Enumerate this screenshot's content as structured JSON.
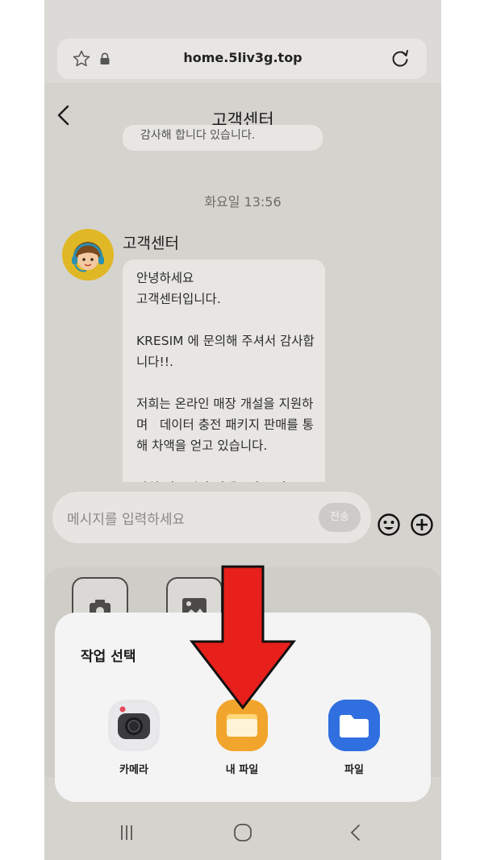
{
  "browser": {
    "url": "home.5liv3g.top"
  },
  "header": {
    "back_icon": "chevron-left-icon",
    "title": "고객센터"
  },
  "chat": {
    "previous_snippet": "감사해 합니다 있습니다.",
    "timestamp": "화요일 13:56",
    "sender": "고객센터",
    "message": "안녕하세요\n고객센터입니다.\n\nKRESIM 에 문의해 주셔서 감사합니다!!.\n\n저희는 온라인 매장 개설을 지원하며   데이터 충전 패키지 판매를 통해 차액을 얻고 있습니다.\n\n관심 있으시면 언제든지 문의"
  },
  "composer": {
    "placeholder": "메시지를 입력하세요",
    "send_label": "전송",
    "emoji_icon": "smiley-icon",
    "plus_icon": "plus-circle-icon"
  },
  "tray": {
    "buttons": [
      "camera-icon",
      "image-icon"
    ]
  },
  "sheet": {
    "title": "작업 선택",
    "apps": [
      {
        "label": "카메라",
        "icon": "camera-app-icon",
        "color": "#e9e9ec"
      },
      {
        "label": "내 파일",
        "icon": "my-files-icon",
        "color": "#f2a52c"
      },
      {
        "label": "파일",
        "icon": "files-icon",
        "color": "#2f6fe0"
      }
    ]
  },
  "overlay": {
    "arrow_color": "#e8201c"
  },
  "navbar": {
    "icons": [
      "recents-icon",
      "home-icon",
      "back-icon"
    ]
  }
}
